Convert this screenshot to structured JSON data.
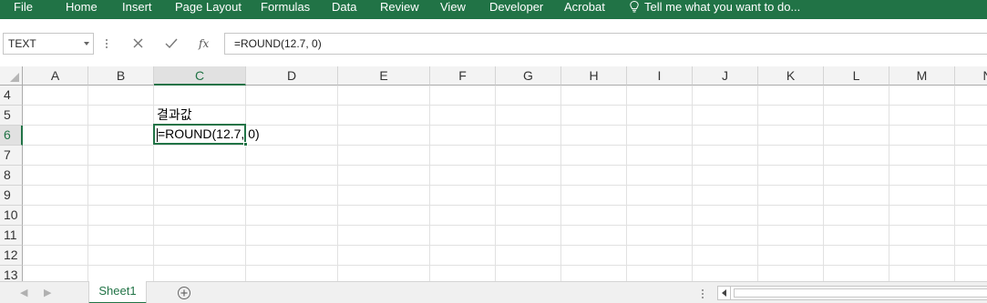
{
  "ribbon": {
    "tabs": [
      "File",
      "Home",
      "Insert",
      "Page Layout",
      "Formulas",
      "Data",
      "Review",
      "View",
      "Developer",
      "Acrobat"
    ],
    "tell_me": "Tell me what you want to do...",
    "accent": "#217346"
  },
  "formula_bar": {
    "name_box": "TEXT",
    "formula": "=ROUND(12.7, 0)"
  },
  "grid": {
    "columns": [
      "A",
      "B",
      "C",
      "D",
      "E",
      "F",
      "G",
      "H",
      "I",
      "J",
      "K",
      "L",
      "M",
      "N"
    ],
    "selected_column": "C",
    "rows": [
      "4",
      "5",
      "6",
      "7",
      "8",
      "9",
      "10",
      "11",
      "12",
      "13"
    ],
    "selected_row": "6",
    "cells": {
      "C5": "결과값",
      "C6": "=ROUND(12.7, 0)"
    }
  },
  "sheets": {
    "tabs": [
      "Sheet1"
    ],
    "active": "Sheet1"
  }
}
